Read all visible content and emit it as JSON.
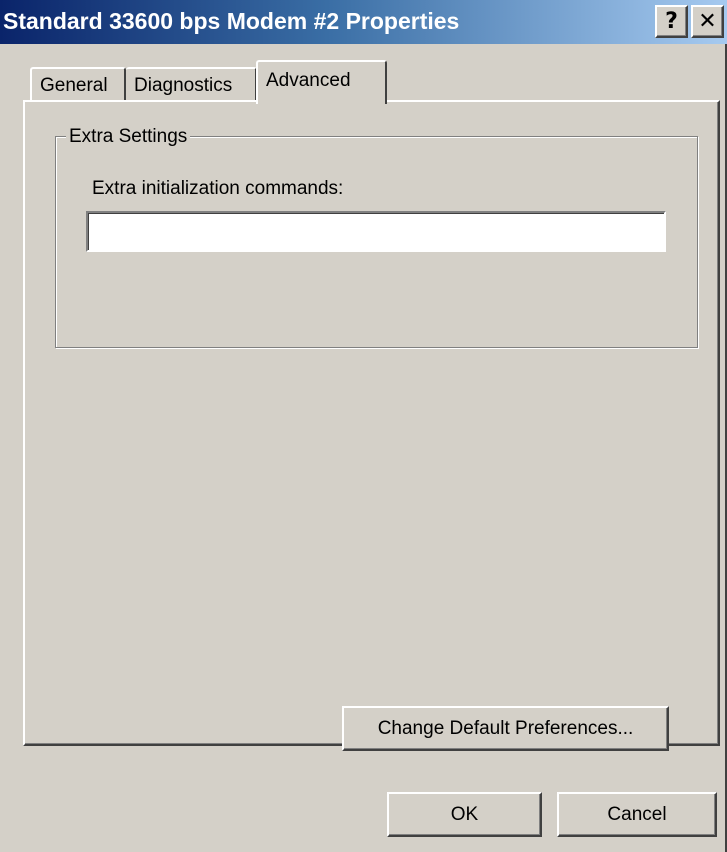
{
  "window": {
    "title": "Standard 33600 bps Modem #2 Properties",
    "help_button_label": "?",
    "close_button_label": "✕"
  },
  "tabs": [
    {
      "label": "General",
      "selected": false
    },
    {
      "label": "Diagnostics",
      "selected": false
    },
    {
      "label": "Advanced",
      "selected": true
    }
  ],
  "extra_settings": {
    "group_title": "Extra Settings",
    "init_commands_label": "Extra initialization commands:",
    "init_commands_value": ""
  },
  "buttons": {
    "change_default_preferences": "Change Default Preferences...",
    "ok": "OK",
    "cancel": "Cancel"
  },
  "colors": {
    "titlebar_start": "#0a246a",
    "titlebar_end": "#a6caf0",
    "dialog_face": "#d4d0c8"
  }
}
